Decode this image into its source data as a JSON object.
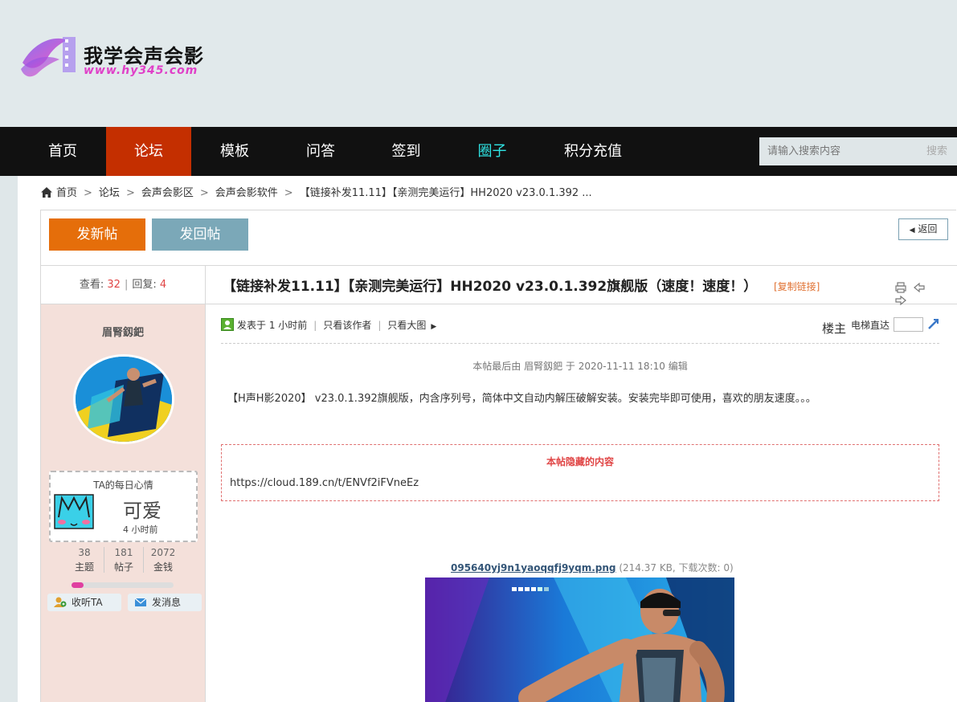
{
  "site": {
    "name": "我学会声会影",
    "url": "www.hy345.com"
  },
  "nav": {
    "items": [
      {
        "label": "首页"
      },
      {
        "label": "论坛"
      },
      {
        "label": "模板"
      },
      {
        "label": "问答"
      },
      {
        "label": "签到"
      },
      {
        "label": "圈子"
      },
      {
        "label": "积分充值"
      }
    ],
    "active_index": 1,
    "search_placeholder": "请输入搜索内容",
    "search_button": "搜索"
  },
  "breadcrumb": [
    "首页",
    "论坛",
    "会声会影区",
    "会声会影软件",
    "【链接补发11.11】【亲测完美运行】HH2020 v23.0.1.392 ..."
  ],
  "actions": {
    "new_thread": "发新帖",
    "reply": "发回帖",
    "back": "返回"
  },
  "thread": {
    "views_label": "查看:",
    "views": "32",
    "replies_label": "回复:",
    "replies": "4",
    "title": "【链接补发11.11】【亲测完美运行】HH2020 v23.0.1.392旗舰版（速度！速度！）",
    "copy_link": "[复制链接]"
  },
  "author": {
    "name": "眉腎釼鈀",
    "mood_title": "TA的每日心情",
    "mood": "可爱",
    "mood_time": "4 小时前",
    "stats": [
      {
        "value": "38",
        "label": "主题"
      },
      {
        "value": "181",
        "label": "帖子"
      },
      {
        "value": "2072",
        "label": "金钱"
      }
    ],
    "progress": 0.12,
    "follow": "收听TA",
    "message": "发消息"
  },
  "post": {
    "posted": "发表于 1 小时前",
    "only_author": "只看该作者",
    "only_image": "只看大图",
    "floor": "楼主",
    "elevator": "电梯直达",
    "edit_note": "本帖最后由 眉腎釼鈀 于 2020-11-11 18:10 编辑",
    "body": "【H声H影2020】 v23.0.1.392旗舰版，内含序列号，简体中文自动内解压破解安装。安装完毕即可使用，喜欢的朋友速度。。。",
    "hidden_title": "本帖隐藏的内容",
    "hidden_url": "https://cloud.189.cn/t/ENVf2iFVneEz",
    "attachment_name": "095640yj9n1yaoqqfj9yqm.png",
    "attachment_info": "(214.37 KB, 下载次数: 0)"
  },
  "colors": {
    "nav_active": "#c42f00",
    "new_btn": "#e56e0a",
    "reply_btn": "#7ba8b8",
    "sidebar": "#f4e0da",
    "accent_red": "#e04545"
  }
}
